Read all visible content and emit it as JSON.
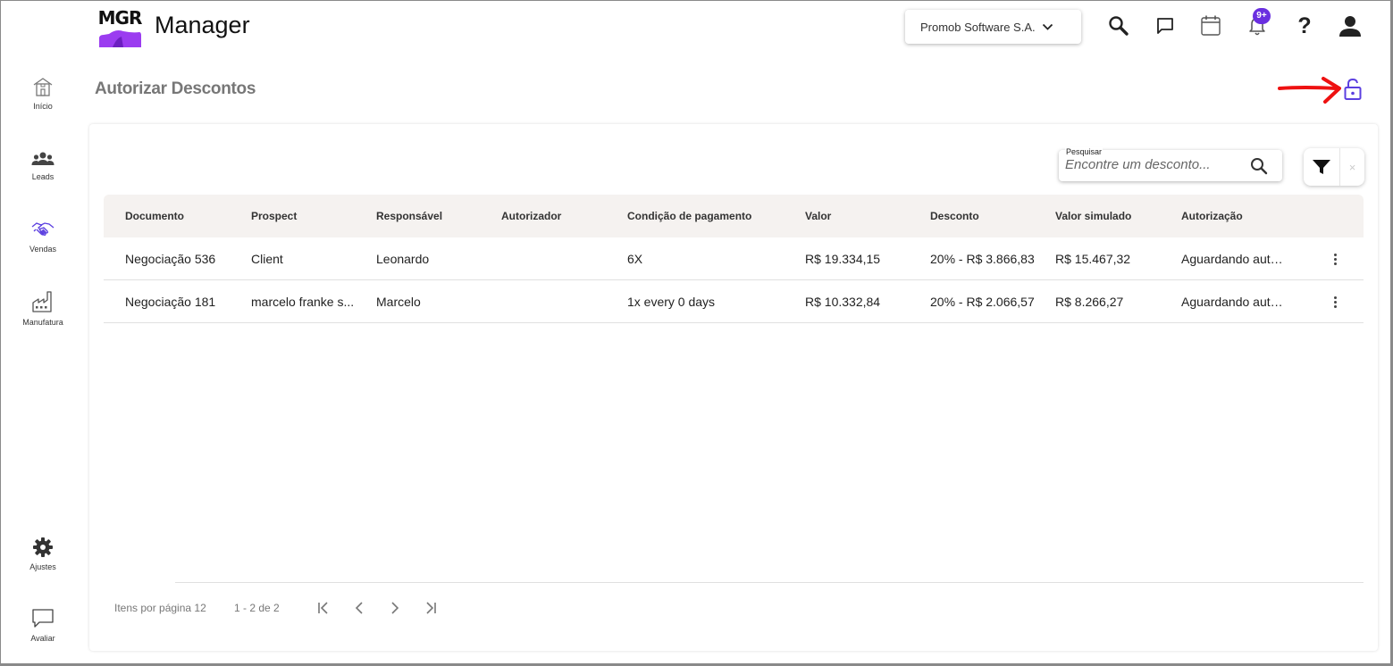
{
  "app": {
    "logo_text": "MGR",
    "title": "Manager"
  },
  "header": {
    "company": "Promob Software S.A.",
    "notifications_badge": "9+",
    "help_label": "?"
  },
  "sidebar": {
    "items": [
      {
        "label": "Início",
        "icon": "home-icon"
      },
      {
        "label": "Leads",
        "icon": "people-icon"
      },
      {
        "label": "Vendas",
        "icon": "handshake-icon"
      },
      {
        "label": "Manufatura",
        "icon": "factory-icon"
      },
      {
        "label": "Ajustes",
        "icon": "gear-icon"
      },
      {
        "label": "Avaliar",
        "icon": "chat-icon"
      }
    ]
  },
  "page": {
    "title": "Autorizar Descontos"
  },
  "search": {
    "label": "Pesquisar",
    "placeholder": "Encontre um desconto..."
  },
  "filter": {
    "clear_label": "×"
  },
  "table": {
    "columns": [
      "Documento",
      "Prospect",
      "Responsável",
      "Autorizador",
      "Condição de pagamento",
      "Valor",
      "Desconto",
      "Valor simulado",
      "Autorização"
    ],
    "rows": [
      [
        "Negociação 536",
        "Client",
        "Leonardo",
        "",
        "6X",
        "R$ 19.334,15",
        "20% - R$ 3.866,83",
        "R$ 15.467,32",
        "Aguardando autorização"
      ],
      [
        "Negociação 181",
        "marcelo franke s...",
        "Marcelo",
        "",
        "1x every 0 days",
        "R$ 10.332,84",
        "20% - R$ 2.066,57",
        "R$ 8.266,27",
        "Aguardando autorização"
      ]
    ]
  },
  "pagination": {
    "items_per_page": "Itens por página 12",
    "range": "1 - 2 de 2"
  },
  "colors": {
    "accent": "#6a2fe0",
    "lock": "#5b3fe0",
    "arrow": "#ee1111",
    "logo_purple": "#9b3cf0"
  }
}
